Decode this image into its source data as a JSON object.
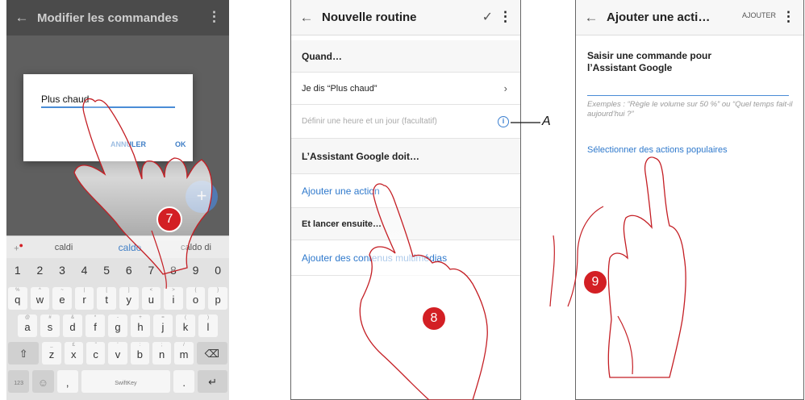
{
  "phone1": {
    "title": "Modifier les commandes",
    "back_icon": "←",
    "more_icon": "⋮",
    "dialog": {
      "input_value": "Plus chaud",
      "cancel_label": "ANNULER",
      "ok_label": "OK"
    },
    "fab_icon": "+",
    "suggestions": {
      "left": "caldi",
      "middle": "caldo",
      "right": "caldo di"
    },
    "keyboard": {
      "numbers": [
        "1",
        "2",
        "3",
        "4",
        "5",
        "6",
        "7",
        "8",
        "9",
        "0"
      ],
      "row1": [
        [
          "q",
          "%"
        ],
        [
          "w",
          "^"
        ],
        [
          "e",
          "~"
        ],
        [
          "r",
          "|"
        ],
        [
          "t",
          "["
        ],
        [
          "y",
          "]"
        ],
        [
          "u",
          "<"
        ],
        [
          "i",
          ">"
        ],
        [
          "o",
          "{"
        ],
        [
          "p",
          "}"
        ]
      ],
      "row2": [
        [
          "a",
          "@"
        ],
        [
          "s",
          "#"
        ],
        [
          "d",
          "&"
        ],
        [
          "f",
          "*"
        ],
        [
          "g",
          "-"
        ],
        [
          "h",
          "+"
        ],
        [
          "j",
          "="
        ],
        [
          "k",
          "("
        ],
        [
          "l",
          ")"
        ]
      ],
      "row3": [
        [
          "z",
          "_"
        ],
        [
          "x",
          "£"
        ],
        [
          "c",
          "\""
        ],
        [
          "v",
          "'"
        ],
        [
          "b",
          ":"
        ],
        [
          "n",
          ";"
        ],
        [
          "m",
          "/"
        ]
      ],
      "shift_icon": "⇧",
      "backspace_icon": "⌫",
      "mode_label": "123",
      "emoji_icon": "☺",
      "comma": ",",
      "space_label": "SwiftKey",
      "period": ".",
      "enter_icon": "↵"
    }
  },
  "phone2": {
    "title": "Nouvelle routine",
    "back_icon": "←",
    "check_icon": "✓",
    "more_icon": "⋮",
    "rows": {
      "when": "Quand…",
      "trigger": "Je dis “Plus chaud”",
      "schedule": "Définir une heure et un jour (facultatif)",
      "assistant": "L’Assistant Google doit…",
      "add_action": "Ajouter une action",
      "then": "Et lancer ensuite…",
      "add_media": "Ajouter des contenus multimédias"
    },
    "chevron_icon": "›",
    "info_icon": "i"
  },
  "phone3": {
    "title": "Ajouter une acti…",
    "add_label": "AJOUTER",
    "back_icon": "←",
    "more_icon": "⋮",
    "prompt": "Saisir une commande pour l’Assistant Google",
    "example": "Exemples : “Règle le volume sur 50 %” ou “Quel temps fait-il aujourd’hui ?”",
    "popular_link": "Sélectionner des actions populaires"
  },
  "callout": "A",
  "steps": [
    "7",
    "8",
    "9"
  ],
  "colors": {
    "accent": "#2f79cc",
    "step_badge": "#d31f24",
    "hand_outline": "#c41e24"
  }
}
